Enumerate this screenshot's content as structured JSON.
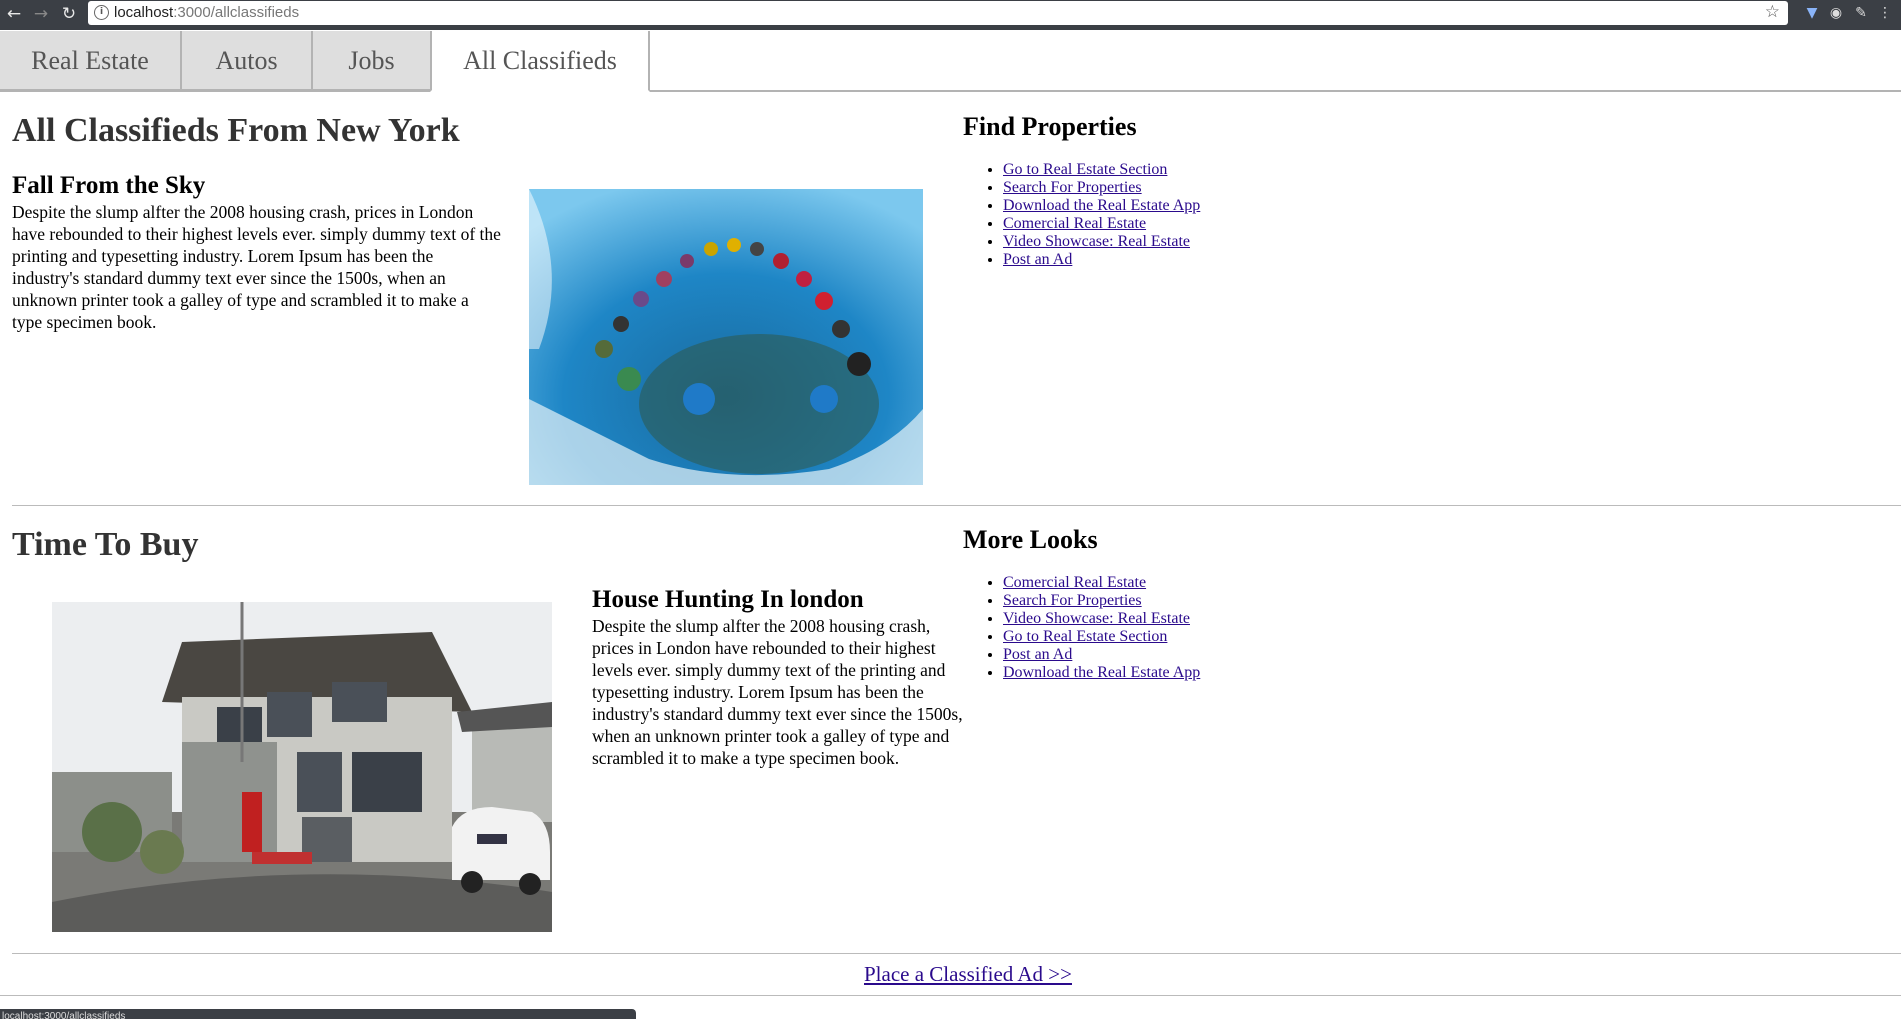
{
  "browser": {
    "url_host": "localhost",
    "url_path": ":3000/allclassifieds",
    "back_icon": "arrow-left-icon",
    "forward_icon": "arrow-right-icon",
    "reload_icon": "reload-icon",
    "bookmark_icon": "star-icon"
  },
  "tabs": [
    {
      "label": "Real Estate"
    },
    {
      "label": "Autos"
    },
    {
      "label": "Jobs"
    },
    {
      "label": "All Classifieds"
    }
  ],
  "main": {
    "title": "All Classifieds From New York",
    "article1": {
      "title": "Fall From the Sky",
      "body": "Despite the slump alfter the 2008 housing crash, prices in London have rebounded to their highest levels ever. simply dummy text of the printing and typesetting industry. Lorem Ipsum has been the industry's standard dummy text ever since the 1500s, when an unknown printer took a galley of type and scrambled it to make a type specimen book."
    },
    "section2_title": "Time To Buy",
    "article2": {
      "title": "House Hunting In london",
      "body": "Despite the slump alfter the 2008 housing crash, prices in London have rebounded to their highest levels ever. simply dummy text of the printing and typesetting industry. Lorem Ipsum has been the industry's standard dummy text ever since the 1500s, when an unknown printer took a galley of type and scrambled it to make a type specimen book."
    },
    "place_ad": "Place a Classified Ad >>"
  },
  "sidebar1": {
    "title": "Find Properties",
    "links": [
      "Go to Real Estate Section",
      "Search For Properties",
      "Download the Real Estate App",
      "Comercial Real Estate",
      "Video Showcase: Real Estate",
      "Post an Ad"
    ]
  },
  "sidebar2": {
    "title": "More Looks",
    "links": [
      "Comercial Real Estate",
      "Search For Properties",
      "Video Showcase: Real Estate",
      "Go to Real Estate Section",
      "Post an Ad",
      "Download the Real Estate App"
    ]
  },
  "status_bar": "localhost:3000/allclassifieds"
}
